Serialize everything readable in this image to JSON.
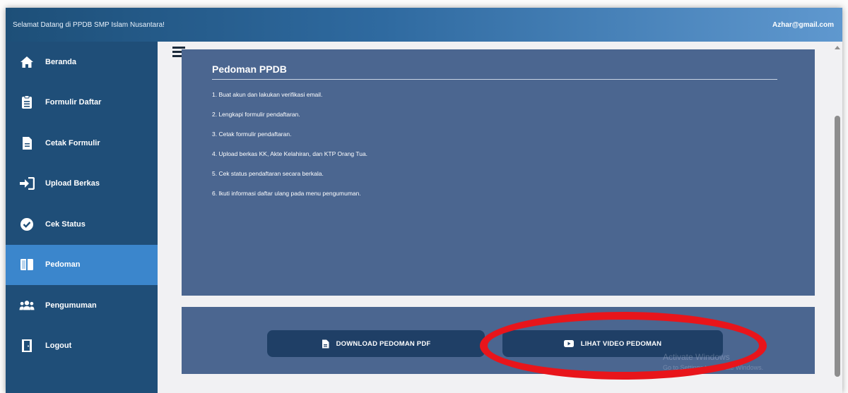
{
  "header": {
    "welcome": "Selamat Datang di PPDB SMP Islam Nusantara!",
    "email": "Azhar@gmail.com"
  },
  "sidebar": {
    "items": [
      {
        "label": "Beranda",
        "icon": "home-icon"
      },
      {
        "label": "Formulir Daftar",
        "icon": "clipboard-icon"
      },
      {
        "label": "Cetak Formulir",
        "icon": "document-icon"
      },
      {
        "label": "Upload Berkas",
        "icon": "sign-in-icon"
      },
      {
        "label": "Cek Status",
        "icon": "check-circle-icon"
      },
      {
        "label": "Pedoman",
        "icon": "book-icon",
        "active": true
      },
      {
        "label": "Pengumuman",
        "icon": "users-icon"
      },
      {
        "label": "Logout",
        "icon": "door-icon"
      }
    ]
  },
  "main": {
    "title": "Pedoman PPDB",
    "steps": [
      "1. Buat akun dan lakukan verifikasi email.",
      "2. Lengkapi formulir pendaftaran.",
      "3. Cetak formulir pendaftaran.",
      "4. Upload berkas KK, Akte Kelahiran, dan KTP Orang Tua.",
      "5. Cek status pendaftaran secara berkala.",
      "6. Ikuti informasi daftar ulang pada menu pengumuman."
    ],
    "buttons": {
      "download_pdf": "DOWNLOAD PEDOMAN PDF",
      "watch_video": "LIHAT VIDEO PEDOMAN"
    }
  },
  "watermark": {
    "line1": "Activate Windows",
    "line2": "Go to Settings to activate Windows."
  },
  "colors": {
    "sidebar": "#1f4e78",
    "sidebar_active": "#3b86cc",
    "panel": "#4b6690",
    "button": "#1f3f66",
    "highlight": "#e8151b"
  }
}
